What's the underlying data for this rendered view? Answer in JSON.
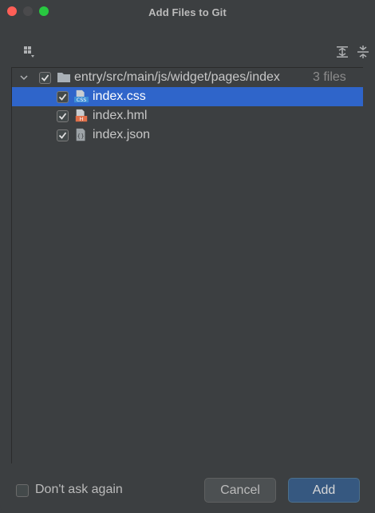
{
  "window": {
    "title": "Add Files to Git"
  },
  "toolbar": {
    "group_icon": "group-by-icon",
    "expand_icon": "expand-all-icon",
    "collapse_icon": "collapse-all-icon"
  },
  "tree": {
    "folder": {
      "path": "entry/src/main/js/widget/pages/index",
      "count": "3 files",
      "checked": true,
      "expanded": true
    },
    "files": [
      {
        "name": "index.css",
        "type": "css",
        "checked": true,
        "selected": true
      },
      {
        "name": "index.hml",
        "type": "hml",
        "checked": true,
        "selected": false
      },
      {
        "name": "index.json",
        "type": "json",
        "checked": true,
        "selected": false
      }
    ]
  },
  "footer": {
    "dont_ask_label": "Don't ask again",
    "dont_ask_checked": false,
    "cancel_label": "Cancel",
    "add_label": "Add"
  },
  "colors": {
    "background": "#3c3f41",
    "selection": "#2f65ca",
    "default_button": "#365880"
  }
}
